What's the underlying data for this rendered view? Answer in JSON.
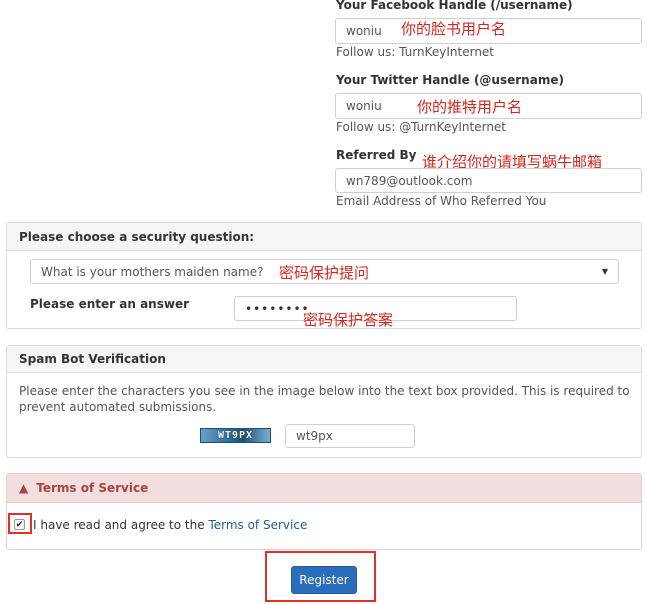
{
  "facebook": {
    "label": "Your Facebook Handle (/username)",
    "value": "woniu",
    "annotation": "你的脸书用户名",
    "help": "Follow us: TurnKeyInternet"
  },
  "twitter": {
    "label": "Your Twitter Handle (@username)",
    "value": "woniu",
    "annotation": "你的推特用户名",
    "help": "Follow us: @TurnKeyInternet"
  },
  "referred": {
    "label": "Referred By",
    "value": "wn789@outlook.com",
    "annotation": "谁介绍你的请填写蜗牛邮箱",
    "help": "Email Address of Who Referred You"
  },
  "security": {
    "heading": "Please choose a security question:",
    "question": "What is your mothers maiden name?",
    "question_annotation": "密码保护提问",
    "answer_label": "Please enter an answer",
    "answer_value": "••••••••",
    "answer_annotation": "密码保护答案"
  },
  "spam": {
    "heading": "Spam Bot Verification",
    "text": "Please enter the characters you see in the image below into the text box provided. This is required to prevent automated submissions.",
    "captcha_text": "WT9PX",
    "input_value": "wt9px"
  },
  "tos": {
    "heading": "Terms of Service",
    "agree_prefix": "I have read and agree to the ",
    "agree_link": "Terms of Service"
  },
  "register_label": "Register",
  "colors": {
    "annotation": "#d9261c",
    "tos_header_bg": "#f2dede",
    "tos_header_text": "#a94442",
    "link": "#1f5f8b",
    "button": "#2a6ebb"
  }
}
